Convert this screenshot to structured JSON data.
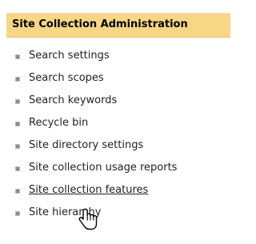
{
  "panel": {
    "title": "Site Collection Administration",
    "items": [
      {
        "label": "Search settings"
      },
      {
        "label": "Search scopes"
      },
      {
        "label": "Search keywords"
      },
      {
        "label": "Recycle bin"
      },
      {
        "label": "Site directory settings"
      },
      {
        "label": "Site collection usage reports"
      },
      {
        "label": "Site collection features"
      },
      {
        "label": "Site hierarchy"
      }
    ],
    "hovered_item": "Site collection features",
    "header_color": "#f7d784"
  },
  "cursor": {
    "icon": "hand-pointer-icon"
  }
}
